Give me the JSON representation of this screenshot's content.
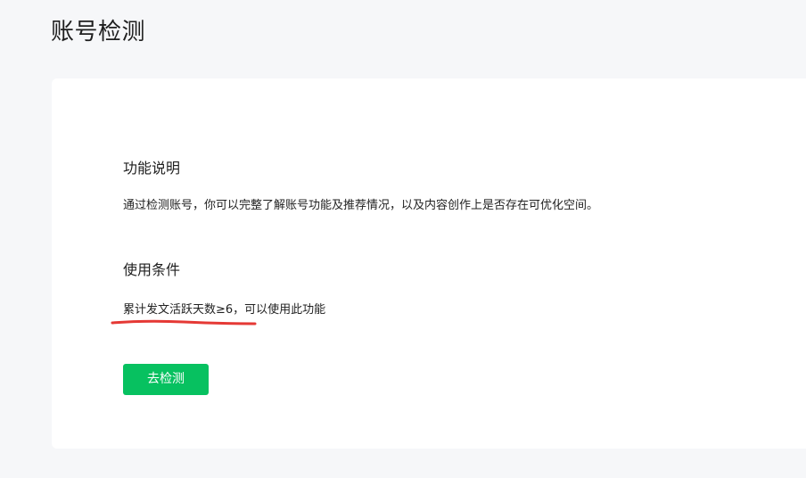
{
  "page": {
    "title": "账号检测"
  },
  "features": {
    "title": "功能说明",
    "description": "通过检测账号，你可以完整了解账号功能及推荐情况，以及内容创作上是否存在可优化空间。"
  },
  "conditions": {
    "title": "使用条件",
    "text": "累计发文活跃天数≥6，可以使用此功能"
  },
  "actions": {
    "check_button_label": "去检测"
  },
  "colors": {
    "primary_button": "#07c160",
    "annotation_underline": "#e53935",
    "page_background": "#f6f7f9",
    "card_background": "#ffffff"
  }
}
